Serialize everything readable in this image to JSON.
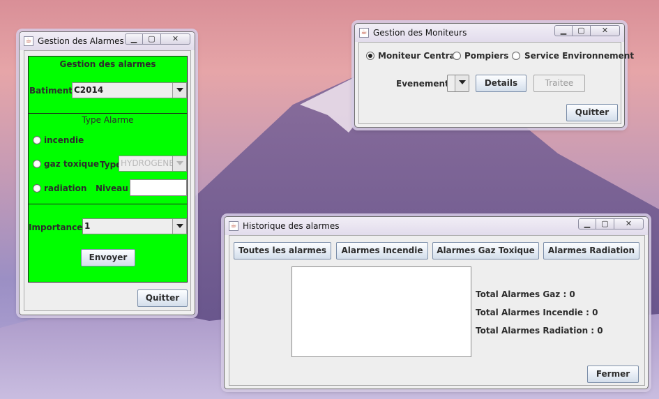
{
  "colors": {
    "panel_green": "#00ff00",
    "window_bg": "#eeeeee"
  },
  "alarm_window": {
    "title": "Gestion des Alarmes",
    "heading": "Gestion des alarmes",
    "batiment_label": "Batiment",
    "batiment_value": "C2014",
    "type_alarme_title": "Type Alarme",
    "radio_incendie": "incendie",
    "radio_gaz": "gaz toxique",
    "type_label": "Type",
    "type_value": "HYDROGENE",
    "radio_radiation": "radiation",
    "niveau_label": "Niveau",
    "niveau_value": "",
    "importance_label": "Importance",
    "importance_value": "1",
    "envoyer": "Envoyer",
    "quitter": "Quitter"
  },
  "monitor_window": {
    "title": "Gestion des Moniteurs",
    "radio_central": "Moniteur Central",
    "radio_pompiers": "Pompiers",
    "radio_env": "Service Environnement",
    "selected_radio": "Moniteur Central",
    "evenement_label": "Evenement",
    "evenement_value": "",
    "details": "Details",
    "traitee": "Traitee",
    "quitter": "Quitter"
  },
  "history_window": {
    "title": "Historique des alarmes",
    "btn_all": "Toutes les alarmes",
    "btn_incendie": "Alarmes Incendie",
    "btn_gaz": "Alarmes Gaz Toxique",
    "btn_radiation": "Alarmes Radiation",
    "total_gaz": "Total Alarmes Gaz : 0",
    "total_incendie": "Total Alarmes Incendie : 0",
    "total_radiation": "Total Alarmes Radiation : 0",
    "fermer": "Fermer"
  }
}
